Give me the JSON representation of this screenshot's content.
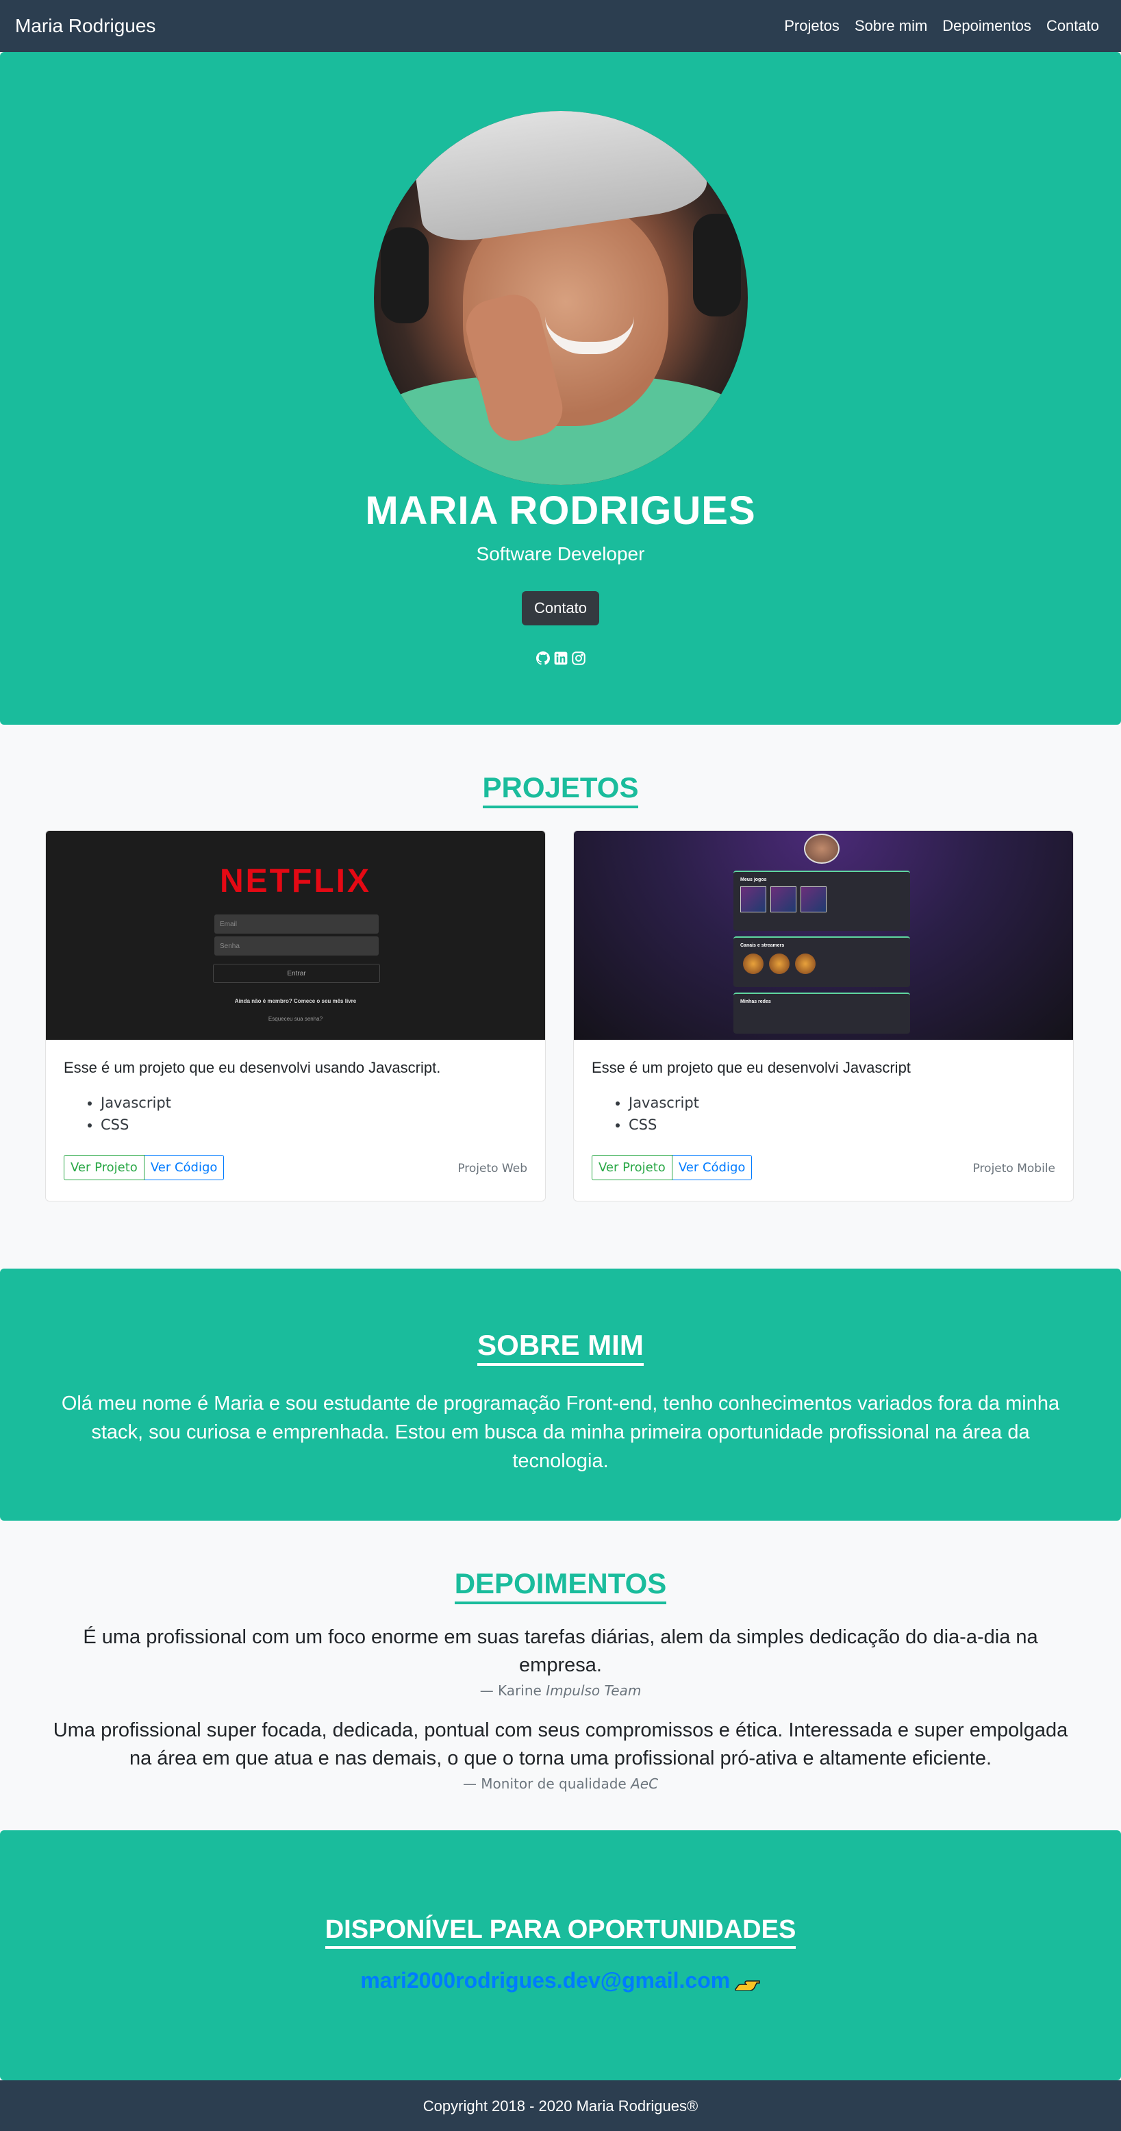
{
  "nav": {
    "brand": "Maria Rodrigues",
    "links": [
      "Projetos",
      "Sobre mim",
      "Depoimentos",
      "Contato"
    ]
  },
  "hero": {
    "name": "MARIA RODRIGUES",
    "role": "Software Developer",
    "button": "Contato",
    "socials": [
      "github-icon",
      "linkedin-icon",
      "instagram-icon"
    ]
  },
  "projects": {
    "title": "PROJETOS",
    "cards": [
      {
        "description": "Esse é um projeto que eu desenvolvi usando Javascript.",
        "tech": [
          "Javascript",
          "CSS"
        ],
        "view_label": "Ver Projeto",
        "code_label": "Ver Código",
        "tag": "Projeto Web",
        "preview": {
          "logo": "NETFLIX",
          "email_placeholder": "Email",
          "password_placeholder": "Senha",
          "button": "Entrar",
          "signup": "Ainda não é membro? Comece o seu mês livre",
          "forgot": "Esqueceu sua senha?"
        }
      },
      {
        "description": "Esse é um projeto que eu desenvolvi Javascript",
        "tech": [
          "Javascript",
          "CSS"
        ],
        "view_label": "Ver Projeto",
        "code_label": "Ver Código",
        "tag": "Projeto Mobile",
        "preview": {
          "panel1": "Meus jogos",
          "panel2": "Canais e streamers",
          "panel3": "Minhas redes"
        }
      }
    ]
  },
  "about": {
    "title": "SOBRE MIM",
    "text": "Olá meu nome é Maria e sou estudante de programação Front-end, tenho conhecimentos variados fora da minha stack, sou curiosa e emprenhada. Estou em busca da minha primeira oportunidade profissional na área da tecnologia."
  },
  "testimonials": {
    "title": "DEPOIMENTOS",
    "items": [
      {
        "text": "É uma profissional com um foco enorme em suas tarefas diárias, alem da simples dedicação do dia-a-dia na empresa.",
        "author": "— Karine",
        "company": "Impulso Team"
      },
      {
        "text": "Uma profissional super focada, dedicada, pontual com seus compromissos e ética. Interessada e super empolgada na área em que atua e nas demais, o que o torna uma profissional pró-ativa e altamente eficiente.",
        "author": "— Monitor de qualidade",
        "company": "AeC"
      }
    ]
  },
  "contact": {
    "title": "DISPONÍVEL PARA OPORTUNIDADES",
    "email": "mari2000rodrigues.dev@gmail.com"
  },
  "footer": {
    "text": "Copyright 2018 - 2020 Maria Rodrigues®"
  },
  "colors": {
    "primary": "#1abc9c",
    "dark": "#2c3e50",
    "button_dark": "#343a40",
    "link": "#007bff",
    "success": "#28a745"
  }
}
